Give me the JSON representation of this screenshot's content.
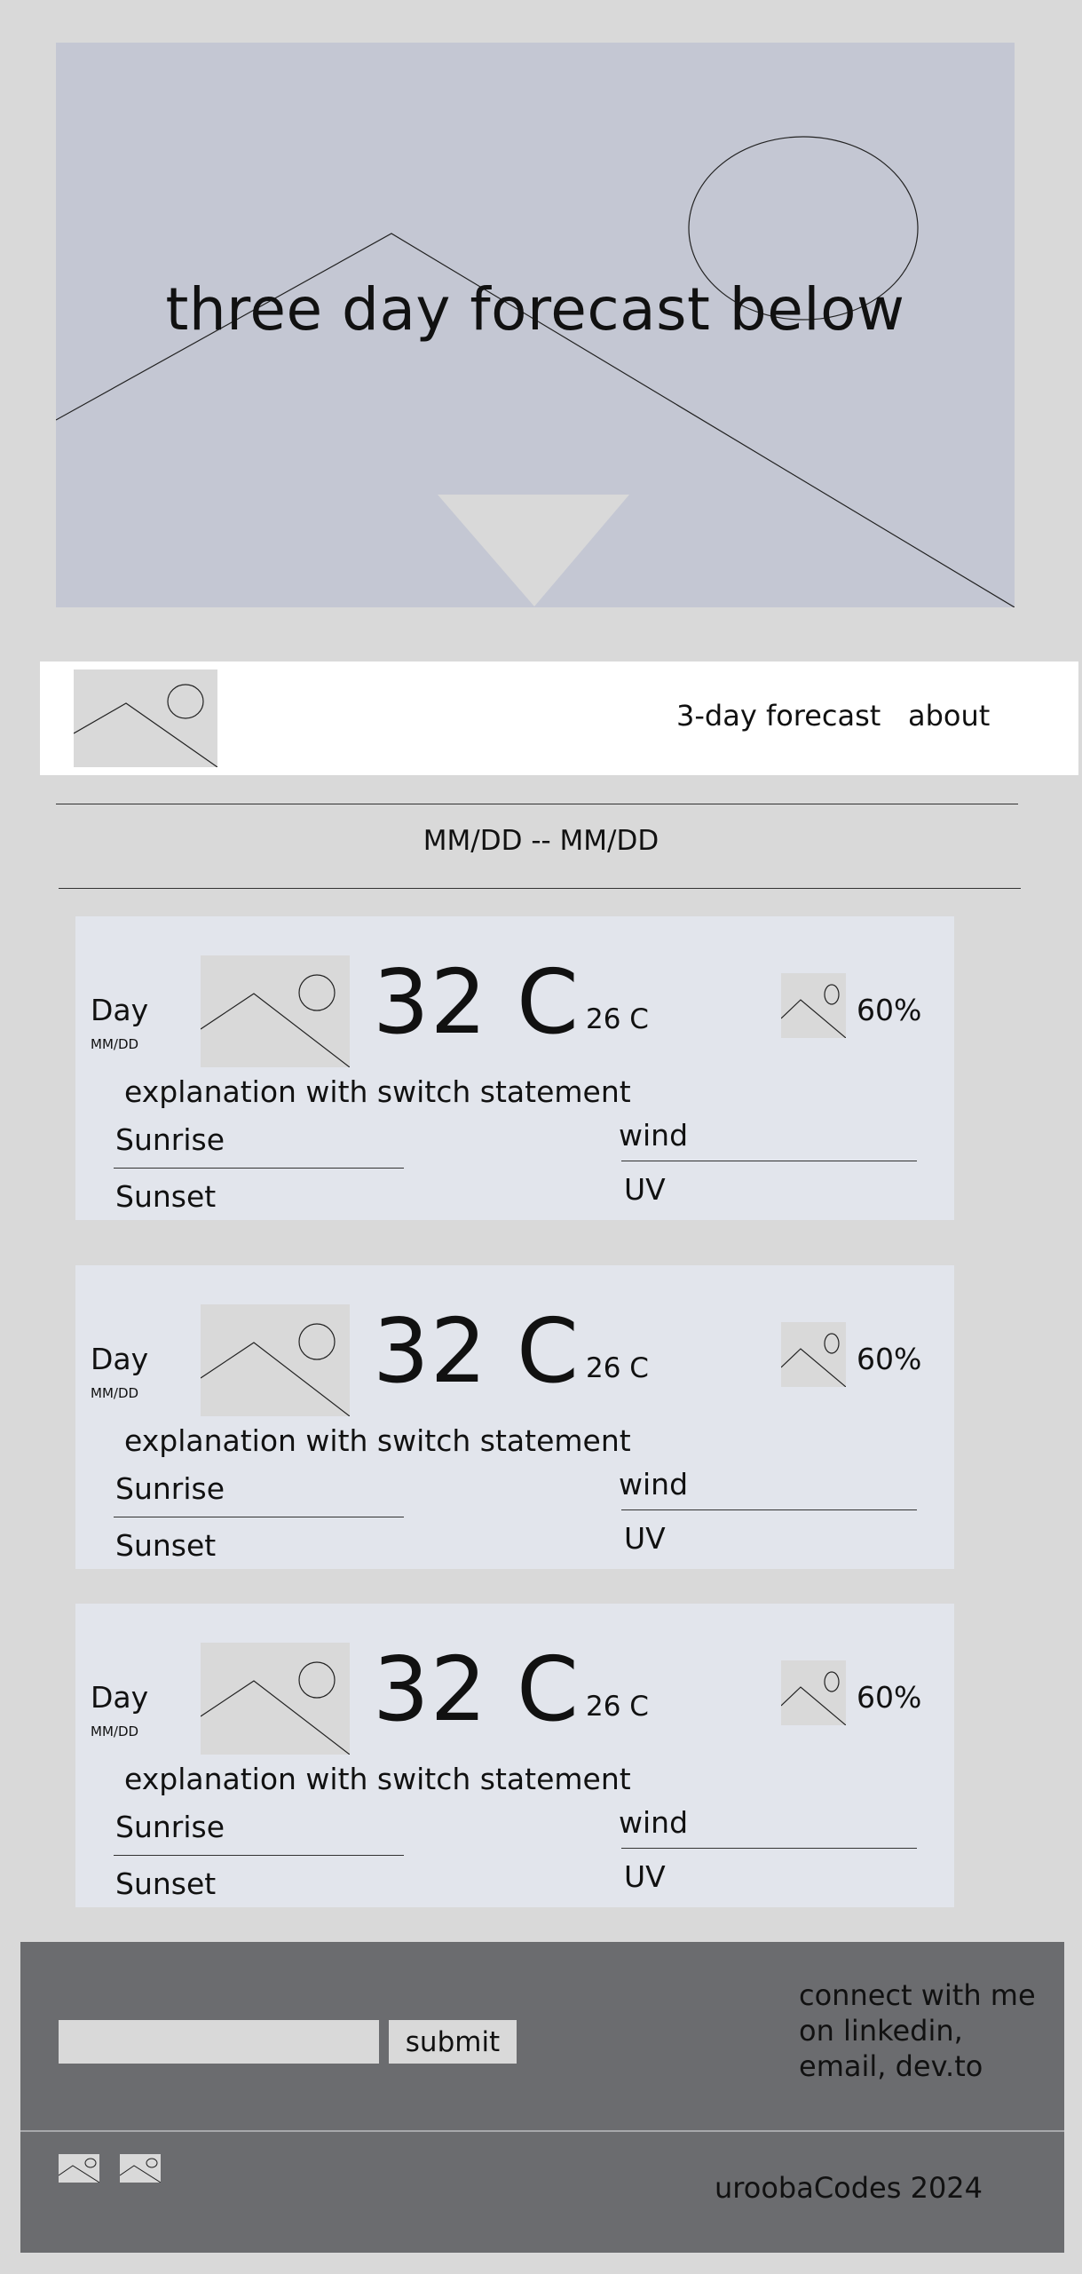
{
  "hero": {
    "title": "three day forecast below",
    "image_icon": "landscape-placeholder-icon"
  },
  "nav": {
    "logo_icon": "image-placeholder-icon",
    "links": [
      "3-day forecast",
      "about"
    ]
  },
  "date_range": "MM/DD -- MM/DD",
  "cards": [
    {
      "day": "Day",
      "date": "MM/DD",
      "temp_high": "32 C",
      "temp_low": "26 C",
      "rain_chance": "60%",
      "explanation": "explanation with switch statement",
      "sunrise": "Sunrise",
      "sunset": "Sunset",
      "wind": "wind",
      "uv": "UV"
    },
    {
      "day": "Day",
      "date": "MM/DD",
      "temp_high": "32 C",
      "temp_low": "26 C",
      "rain_chance": "60%",
      "explanation": "explanation with switch statement",
      "sunrise": "Sunrise",
      "sunset": "Sunset",
      "wind": "wind",
      "uv": "UV"
    },
    {
      "day": "Day",
      "date": "MM/DD",
      "temp_high": "32 C",
      "temp_low": "26 C",
      "rain_chance": "60%",
      "explanation": "explanation with switch statement",
      "sunrise": "Sunrise",
      "sunset": "Sunset",
      "wind": "wind",
      "uv": "UV"
    }
  ],
  "footer": {
    "email_value": "",
    "submit_label": "submit",
    "connect_lines": [
      "connect with me",
      "on linkedin,",
      "email, dev.to"
    ],
    "social_icons": [
      "image-placeholder-icon",
      "image-placeholder-icon"
    ],
    "copyright": "uroobaCodes 2024"
  },
  "colors": {
    "page_bg": "#d9d9d9",
    "hero_bg": "#c4c7d3",
    "card_bg": "#e2e5ec",
    "footer_bg": "#6b6c6f",
    "nav_bg": "#ffffff"
  }
}
